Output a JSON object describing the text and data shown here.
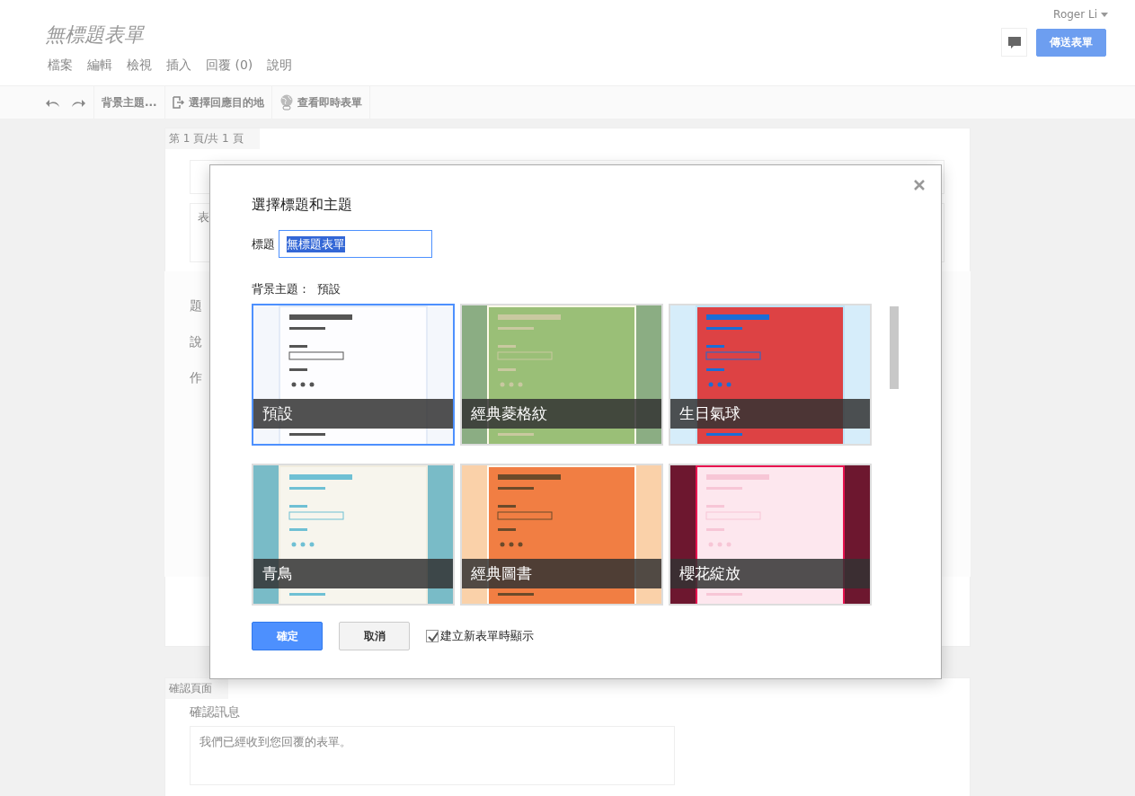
{
  "header": {
    "title": "無標題表單",
    "user": "Roger Li",
    "send_button": "傳送表單"
  },
  "menu": [
    "檔案",
    "編輯",
    "檢視",
    "插入",
    "回覆 (0)",
    "說明"
  ],
  "toolbar": [
    "背景主題...",
    "選擇回應目的地",
    "查看即時表單"
  ],
  "form_page": {
    "page_label": "第 1 頁/共 1 頁",
    "description_fragment": "表",
    "labels": [
      "題",
      "說",
      "作"
    ]
  },
  "confirmation_page": {
    "page_label": "確認頁面",
    "message_label": "確認訊息",
    "message": "我們已經收到您回覆的表單。"
  },
  "dialog": {
    "title": "選擇標題和主題",
    "title_label": "標題",
    "title_value": "無標題表單",
    "theme_label": "背景主題：",
    "theme_value": "預設",
    "themes": [
      {
        "name": "預設",
        "selected": true
      },
      {
        "name": "經典菱格紋",
        "selected": false
      },
      {
        "name": "生日氣球",
        "selected": false
      },
      {
        "name": "青鳥",
        "selected": false
      },
      {
        "name": "經典圖書",
        "selected": false
      },
      {
        "name": "櫻花綻放",
        "selected": false
      }
    ],
    "ok": "確定",
    "cancel": "取消",
    "show_on_new": {
      "label": "建立新表單時顯示",
      "checked": true
    }
  }
}
